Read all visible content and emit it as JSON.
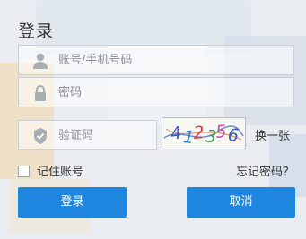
{
  "login": {
    "title": "登录",
    "username_placeholder": "账号/手机号码",
    "password_placeholder": "密码",
    "captcha_placeholder": "验证码",
    "captcha_text": "412356",
    "refresh_captcha_label": "换一张",
    "remember_label": "记住账号",
    "remember_checked": false,
    "forgot_label": "忘记密码？",
    "login_button": "登录",
    "cancel_button": "取消"
  },
  "icons": {
    "username": "user-icon",
    "password": "lock-icon",
    "captcha": "shield-icon"
  },
  "colors": {
    "primary": "#1f86e0",
    "captcha_digits": [
      "#3a5bbf",
      "#2a7fd0",
      "#d6433a",
      "#3aa24a",
      "#c94fb0",
      "#3a5bbf"
    ]
  }
}
